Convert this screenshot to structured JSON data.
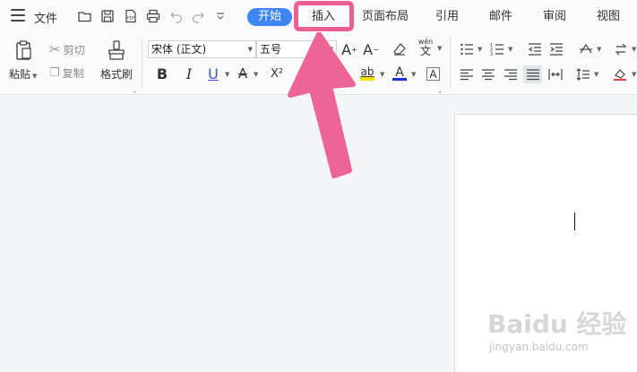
{
  "menubar": {
    "file_label": "文件",
    "tabs": [
      "开始",
      "插入",
      "页面布局",
      "引用",
      "邮件",
      "审阅",
      "视图"
    ],
    "active_tab": "开始",
    "highlighted_tab": "插入"
  },
  "ribbon": {
    "paste_label": "粘贴",
    "cut_label": "剪切",
    "copy_label": "复制",
    "format_painter_label": "格式刷",
    "font_name": "宋体 (正文)",
    "font_size": "五号",
    "bold_glyph": "B",
    "italic_glyph": "I",
    "underline_glyph": "U",
    "superscript_glyph": "X²",
    "subscript_glyph": "X",
    "grow_font_glyph": "A",
    "shrink_font_glyph": "A",
    "strike_glyph": "A",
    "highlight_glyph": "ab",
    "font_color_glyph": "A",
    "char_border_glyph": "A",
    "phonetic_glyph": "wén"
  },
  "watermark": {
    "main": "Baidu 经验",
    "sub": "jingyan.baidu.com"
  },
  "colors": {
    "accent": "#3d84f5",
    "annotation": "#ec5f91",
    "highlight_yellow": "#f5e100",
    "font_color_blue": "#1a2fd8"
  }
}
